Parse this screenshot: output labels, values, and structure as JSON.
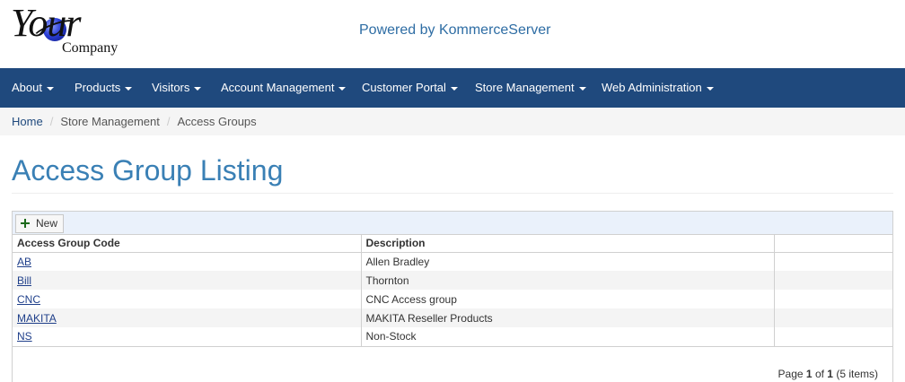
{
  "header": {
    "logo_text": "Your",
    "logo_subtext": "Company",
    "powered_by": "Powered by KommerceServer"
  },
  "nav": {
    "items": [
      {
        "label": "About"
      },
      {
        "label": "Products"
      },
      {
        "label": "Visitors"
      },
      {
        "label": "Account Management"
      },
      {
        "label": "Customer Portal"
      },
      {
        "label": "Store Management"
      },
      {
        "label": "Web Administration"
      }
    ]
  },
  "breadcrumb": {
    "home": "Home",
    "separator": "/",
    "store": "Store Management",
    "current": "Access Groups"
  },
  "page": {
    "title": "Access Group Listing"
  },
  "grid": {
    "new_label": "New",
    "columns": [
      "Access Group Code",
      "Description",
      ""
    ],
    "rows": [
      {
        "code": "AB",
        "description": "Allen Bradley"
      },
      {
        "code": "Bill",
        "description": "Thornton"
      },
      {
        "code": "CNC",
        "description": "CNC Access group"
      },
      {
        "code": "MAKITA",
        "description": "MAKITA Reseller Products"
      },
      {
        "code": "NS",
        "description": "Non-Stock"
      }
    ],
    "pager": {
      "prefix": "Page",
      "page": "1",
      "of": "of",
      "total_pages": "1",
      "items": "(5 items)"
    }
  },
  "colors": {
    "navbar": "#1f497d",
    "title": "#3a80b5",
    "powered": "#2e6da4",
    "toolbar": "#eaf1fb"
  },
  "icons": {
    "new_button_icon": "plus-icon",
    "nav_dropdown_icon": "caret-down-icon"
  }
}
